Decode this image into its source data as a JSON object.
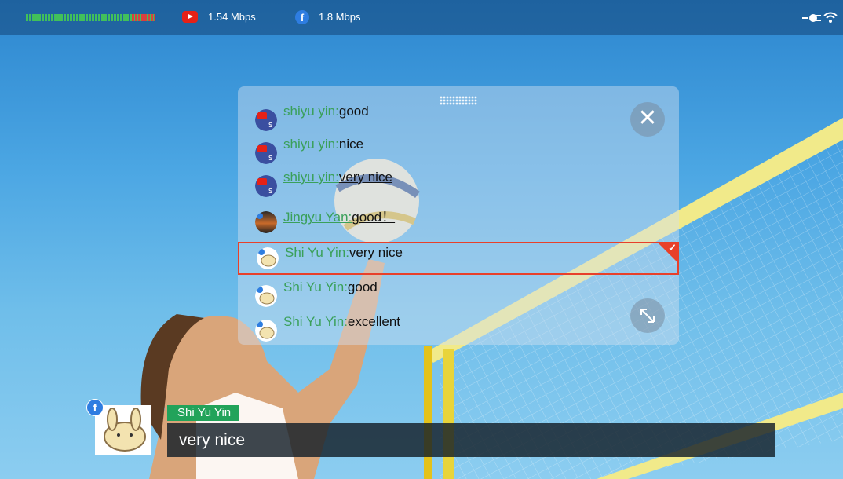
{
  "statusbar": {
    "youtube_icon": "youtube-icon",
    "youtube_bitrate": "1.54 Mbps",
    "facebook_icon": "facebook-icon",
    "facebook_bitrate": "1.8 Mbps",
    "facebook_glyph": "f",
    "power_icon": "plug-icon",
    "wifi_icon": "wifi-icon"
  },
  "chat": {
    "close_glyph": "✕",
    "messages": [
      {
        "name": "shiyu yin:",
        "text": "good",
        "platform": "youtube",
        "underlined": false
      },
      {
        "name": "shiyu yin:",
        "text": "nice",
        "platform": "youtube",
        "underlined": false
      },
      {
        "name": "shiyu yin:",
        "text": "very nice",
        "platform": "youtube",
        "underlined": true
      },
      {
        "name": "Jingyu Yan:",
        "text": "good！",
        "platform": "facebook",
        "underlined": true
      },
      {
        "name": "Shi Yu Yin:",
        "text": "very nice",
        "platform": "facebook",
        "underlined": true,
        "selected": true
      },
      {
        "name": "Shi Yu Yin:",
        "text": "good",
        "platform": "facebook",
        "underlined": false
      },
      {
        "name": "Shi Yu Yin:",
        "text": "excellent",
        "platform": "facebook",
        "underlined": false
      }
    ],
    "selected_check": "✓"
  },
  "overlay": {
    "facebook_glyph": "f",
    "name": "Shi Yu Yin",
    "message": "very nice"
  },
  "colors": {
    "accent_red": "#e8402a",
    "name_green": "#3aa05a",
    "badge_green": "#22a35a",
    "youtube_red": "#e62117",
    "facebook_blue": "#2e7de1"
  }
}
